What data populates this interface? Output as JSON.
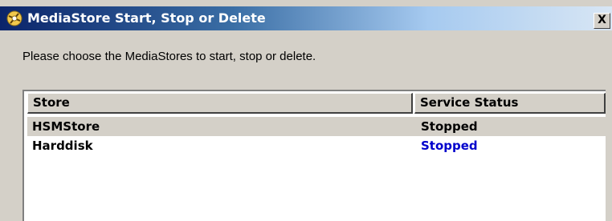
{
  "window": {
    "title": "MediaStore Start, Stop or Delete",
    "close_label": "X",
    "icon": "mediastore-app-icon"
  },
  "prompt": "Please choose the MediaStores to start, stop or delete.",
  "table": {
    "columns": [
      "Store",
      "Service Status"
    ],
    "rows": [
      {
        "store": "HSMStore",
        "status": "Stopped",
        "status_color": "#000000",
        "selected": true
      },
      {
        "store": "Harddisk",
        "status": "Stopped",
        "status_color": "#0000cc",
        "selected": false
      }
    ]
  }
}
